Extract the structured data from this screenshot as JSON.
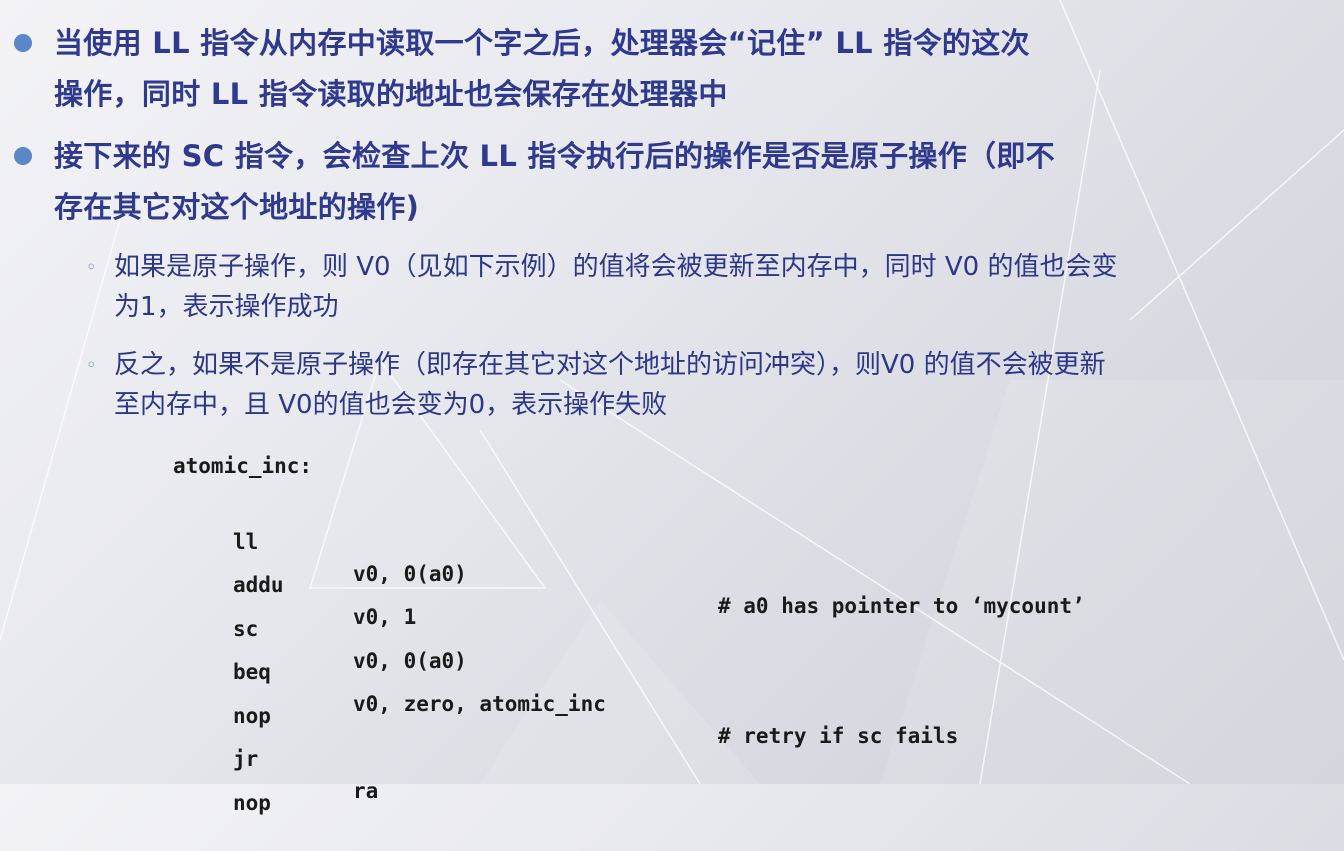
{
  "bullets": [
    {
      "lines": [
        "当使用 LL 指令从内存中读取一个字之后，处理器会“记住” LL 指令的这次",
        "操作，同时 LL 指令读取的地址也会保存在处理器中"
      ],
      "sub": []
    },
    {
      "lines": [
        "接下来的 SC 指令，会检查上次 LL 指令执行后的操作是否是原子操作（即不",
        "存在其它对这个地址的操作)"
      ],
      "sub": [
        {
          "lines": [
            "如果是原子操作，则 V0（见如下示例）的值将会被更新至内存中，同时 V0 的值也会变",
            "为1，表示操作成功"
          ]
        },
        {
          "lines": [
            "反之，如果不是原子操作（即存在其它对这个地址的访问冲突），则V0 的值不会被更新",
            "至内存中，且 V0的值也会变为0，表示操作失败"
          ]
        }
      ]
    }
  ],
  "code": {
    "label": "atomic_inc:",
    "instructions": [
      {
        "op": "ll",
        "args": "v0, 0(a0)",
        "comment": "# a0 has pointer to ‘mycount’"
      },
      {
        "op": "addu",
        "args": "v0, 1",
        "comment": ""
      },
      {
        "op": "sc",
        "args": "v0, 0(a0)",
        "comment": ""
      },
      {
        "op": "beq",
        "args": "v0, zero, atomic_inc",
        "comment": "# retry if sc fails"
      },
      {
        "op": "nop",
        "args": "",
        "comment": ""
      },
      {
        "op": "jr",
        "args": "ra",
        "comment": ""
      },
      {
        "op": "nop",
        "args": "",
        "comment": ""
      }
    ]
  },
  "colors": {
    "heading_text": "#2f3a8f",
    "bullet_dot": "#5b87c8",
    "code_text": "#1a1a1a"
  }
}
